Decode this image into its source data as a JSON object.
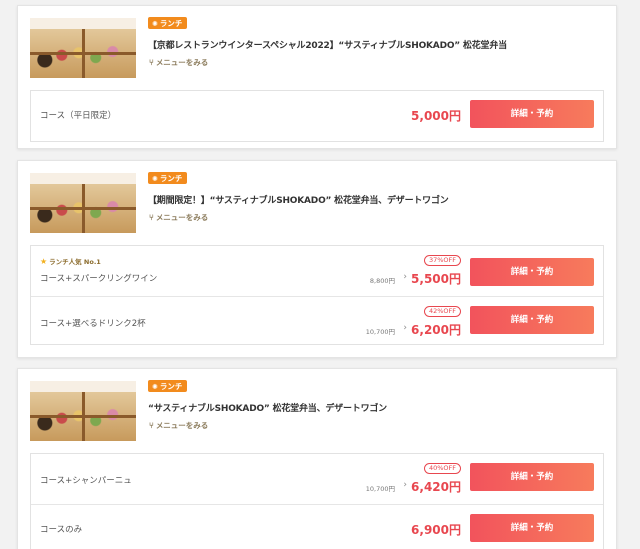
{
  "cards": [
    {
      "badge": "ランチ",
      "title": "【京都レストランウインタースペシャル2022】“サスティナブルSHOKADO” 松花堂弁当",
      "menu_link": "メニューをみる",
      "plans": [
        {
          "name": "コース（平日限定）",
          "price": "5,000円",
          "button": "詳細・予約"
        }
      ]
    },
    {
      "badge": "ランチ",
      "title": "【期間限定！】“サスティナブルSHOKADO” 松花堂弁当、デザートワゴン",
      "menu_link": "メニューをみる",
      "plans": [
        {
          "rank": "ランチ人気 No.1",
          "name": "コース+スパークリングワイン",
          "off": "37%OFF",
          "orig": "8,800円",
          "price": "5,500円",
          "button": "詳細・予約"
        },
        {
          "name": "コース+選べるドリンク2杯",
          "off": "42%OFF",
          "orig": "10,700円",
          "price": "6,200円",
          "button": "詳細・予約"
        }
      ]
    },
    {
      "badge": "ランチ",
      "title": "“サスティナブルSHOKADO” 松花堂弁当、デザートワゴン",
      "menu_link": "メニューをみる",
      "plans": [
        {
          "name": "コース+シャンパーニュ",
          "off": "40%OFF",
          "orig": "10,700円",
          "price": "6,420円",
          "button": "詳細・予約"
        },
        {
          "name": "コースのみ",
          "price": "6,900円",
          "button": "詳細・予約"
        }
      ]
    }
  ],
  "icons": {
    "badge": "sun-icon",
    "menu_link": "fork-knife-icon",
    "rank": "star-icon",
    "price_arrow": "chevron-right-icon"
  },
  "colors": {
    "badge": "#f28b1d",
    "price": "#e8474f",
    "button_start": "#f2535c",
    "button_end": "#f77b5c",
    "background": "#f2f2f2"
  }
}
